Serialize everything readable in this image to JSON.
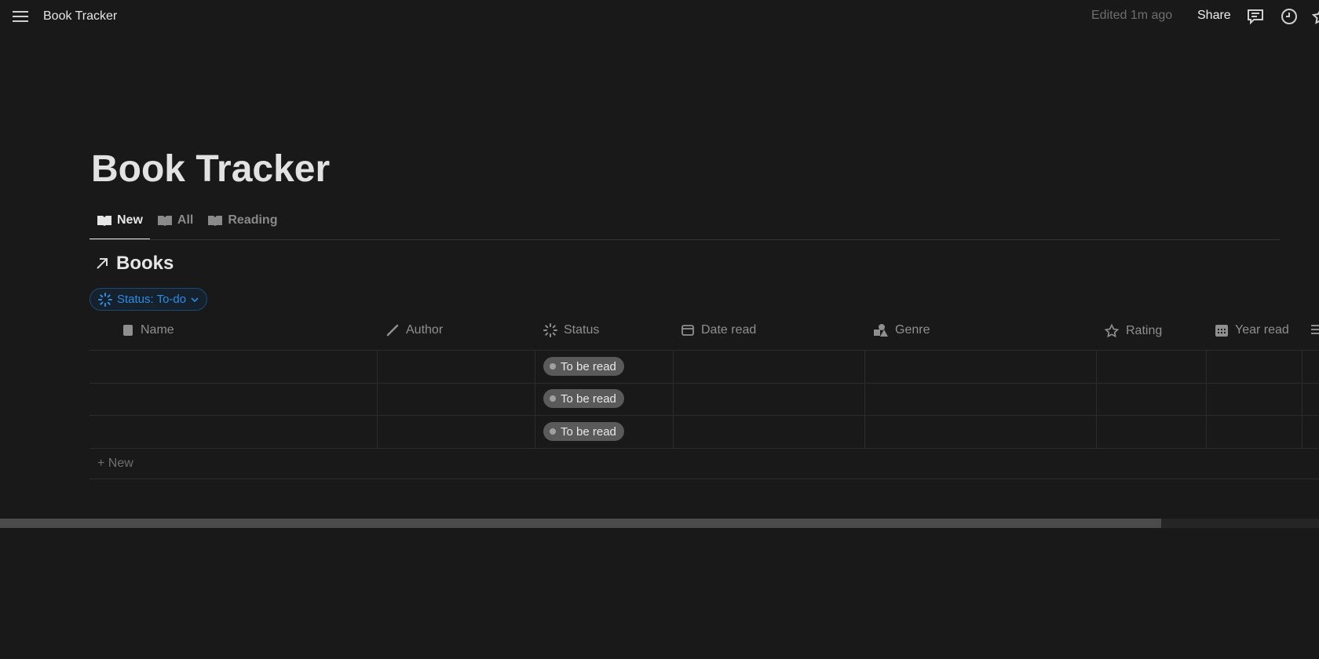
{
  "topbar": {
    "breadcrumb": "Book Tracker",
    "edited": "Edited 1m ago",
    "share": "Share"
  },
  "page": {
    "title": "Book Tracker"
  },
  "tabs": [
    {
      "label": "New",
      "active": true
    },
    {
      "label": "All"
    },
    {
      "label": "Reading"
    }
  ],
  "database": {
    "title": "Books",
    "filter": "Status: To-do"
  },
  "columns": [
    "Name",
    "Author",
    "Status",
    "Date read",
    "Genre",
    "Rating",
    "Year read"
  ],
  "rows": [
    {
      "name": "",
      "author": "",
      "status": "To be read"
    },
    {
      "name": "",
      "author": "",
      "status": "To be read"
    },
    {
      "name": "",
      "author": "",
      "status": "To be read"
    }
  ],
  "new_row": "+ New",
  "colors": {
    "accent": "#2e8be0",
    "pill": "#5a5a5a",
    "bg": "#191919"
  }
}
